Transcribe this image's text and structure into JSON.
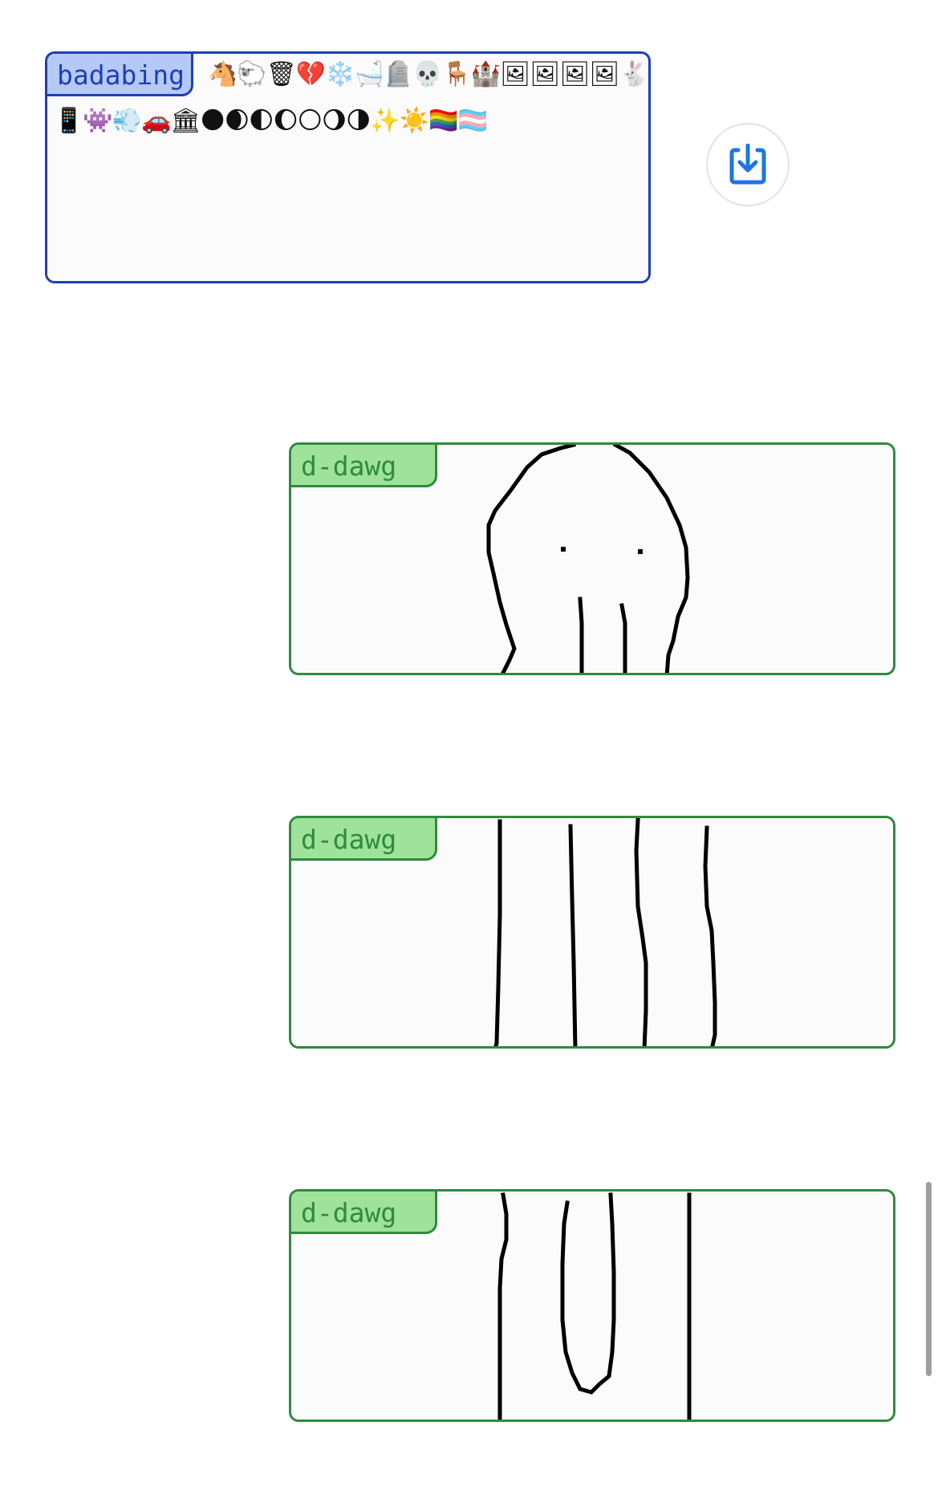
{
  "messages": [
    {
      "author": "badabing",
      "emoji_line_1": "🐴🐑🗑💔❄️🛁🪦💀🪑🏰🖼🖼🖼🖼🐇",
      "emoji_line_2": "📱👾💨🚗🏛🌑🌒🌓🌔🌕🌖🌗✨☀️🏳️‍🌈🏳️‍⚧️"
    },
    {
      "author": "d-dawg",
      "drawing": "squid-head-sketch"
    },
    {
      "author": "d-dawg",
      "drawing": "vertical-lines-sketch"
    },
    {
      "author": "d-dawg",
      "drawing": "tentacle-end-sketch"
    }
  ],
  "save_button": {
    "icon": "download-icon",
    "color": "#1e73e8"
  },
  "colors": {
    "blue_border": "#1f3fb5",
    "blue_tag": "#b4c9f6",
    "green_border": "#2f8a3f",
    "green_tag": "#9fe29b"
  }
}
